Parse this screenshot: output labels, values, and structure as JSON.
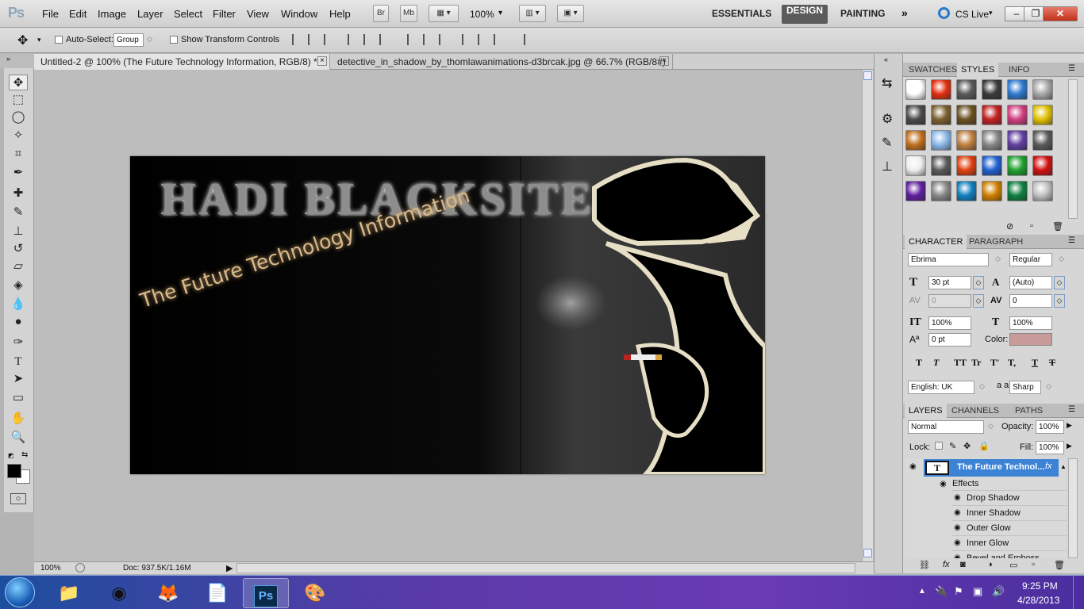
{
  "menubar": {
    "logo": "Ps",
    "menus": [
      "File",
      "Edit",
      "Image",
      "Layer",
      "Select",
      "Filter",
      "View",
      "Window",
      "Help"
    ],
    "bridge": "Br",
    "minibridge": "Mb",
    "zoom": "100%",
    "workspaces": {
      "essentials": "ESSENTIALS",
      "design": "DESIGN",
      "painting": "PAINTING"
    },
    "cslive": "CS Live"
  },
  "options": {
    "auto_select_label": "Auto-Select:",
    "auto_select_value": "Group",
    "show_transform": "Show Transform Controls"
  },
  "tabs": [
    {
      "label": "Untitled-2 @ 100% (The Future Technology Information, RGB/8) *",
      "close": "×"
    },
    {
      "label": "detective_in_shadow_by_thomlawanimations-d3brcak.jpg @ 66.7% (RGB/8#)",
      "close": "×"
    }
  ],
  "artwork": {
    "headline": "HADI BLACKSITE",
    "tagline": "The Future Technology Information"
  },
  "status": {
    "zoom": "100%",
    "doc": "Doc: 937.5K/1.16M"
  },
  "styles_panel": {
    "tabs": [
      "SWATCHES",
      "STYLES",
      "INFO"
    ],
    "swatch_colors": [
      "#ffffff",
      "#e03010",
      "#5a5a5a",
      "#3a3a3a",
      "#2f7ad0",
      "#a8a8a8",
      "#4a4a4a",
      "#7a6030",
      "#6a5020",
      "#c02020",
      "#d04080",
      "#e0c000",
      "#c07020",
      "#8ab8e8",
      "#c08040",
      "#888888",
      "#6040a0",
      "#5a5a5a",
      "#eeeeee",
      "#5a5a5a",
      "#e04010",
      "#2060d0",
      "#20a030",
      "#d01010",
      "#6020a0",
      "#888888",
      "#1080c0",
      "#d08000",
      "#108040",
      "#c0c0c0"
    ]
  },
  "character": {
    "tabs": [
      "CHARACTER",
      "PARAGRAPH"
    ],
    "font": "Ebrima",
    "style": "Regular",
    "size": "30 pt",
    "leading": "(Auto)",
    "kerning": "0",
    "tracking": "0",
    "vscale": "100%",
    "hscale": "100%",
    "baseline": "0 pt",
    "color_label": "Color:",
    "color": "#c89a9a",
    "type_buttons": [
      "T",
      "T",
      "TT",
      "Tr",
      "T'",
      "T,",
      "T",
      "T"
    ],
    "language": "English: UK",
    "aa_label": "a a",
    "aa": "Sharp"
  },
  "layers": {
    "tabs": [
      "LAYERS",
      "CHANNELS",
      "PATHS"
    ],
    "blend": "Normal",
    "opacity_label": "Opacity:",
    "opacity": "100%",
    "lock_label": "Lock:",
    "fill_label": "Fill:",
    "fill": "100%",
    "layer_name": "The Future Technol...",
    "fx": "fx",
    "effects_label": "Effects",
    "effects": [
      "Drop Shadow",
      "Inner Shadow",
      "Outer Glow",
      "Inner Glow",
      "Bevel and Emboss"
    ]
  },
  "taskbar": {
    "time": "9:25 PM",
    "date": "4/28/2013",
    "ps_label": "Ps"
  }
}
